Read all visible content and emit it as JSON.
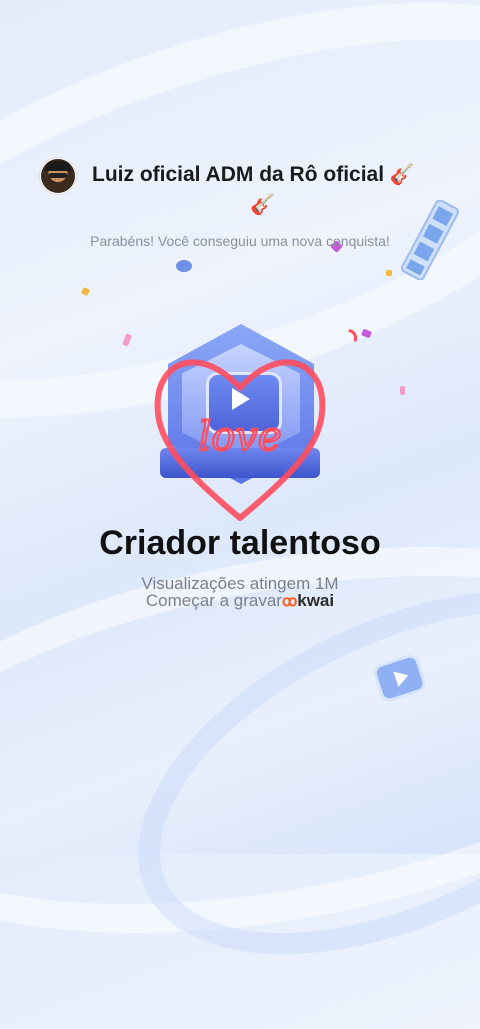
{
  "header": {
    "user_name": "Luiz oficial ADM da Rô oficial",
    "guitar_icon": "guitar-icon",
    "message": "Parabéns! Você conseguiu uma nova conquista!"
  },
  "achievement": {
    "badge_icon": "video-play-badge-icon",
    "overlay_text": "love",
    "title": "Criador talentoso",
    "description": "Visualizações atingem 1M",
    "cta_prefix": "Começar a gravar",
    "brand": "kwai"
  },
  "colors": {
    "accent_blue": "#5a72e6",
    "heart_red": "#ff4d5e",
    "brand_orange": "#ff5a1f"
  }
}
